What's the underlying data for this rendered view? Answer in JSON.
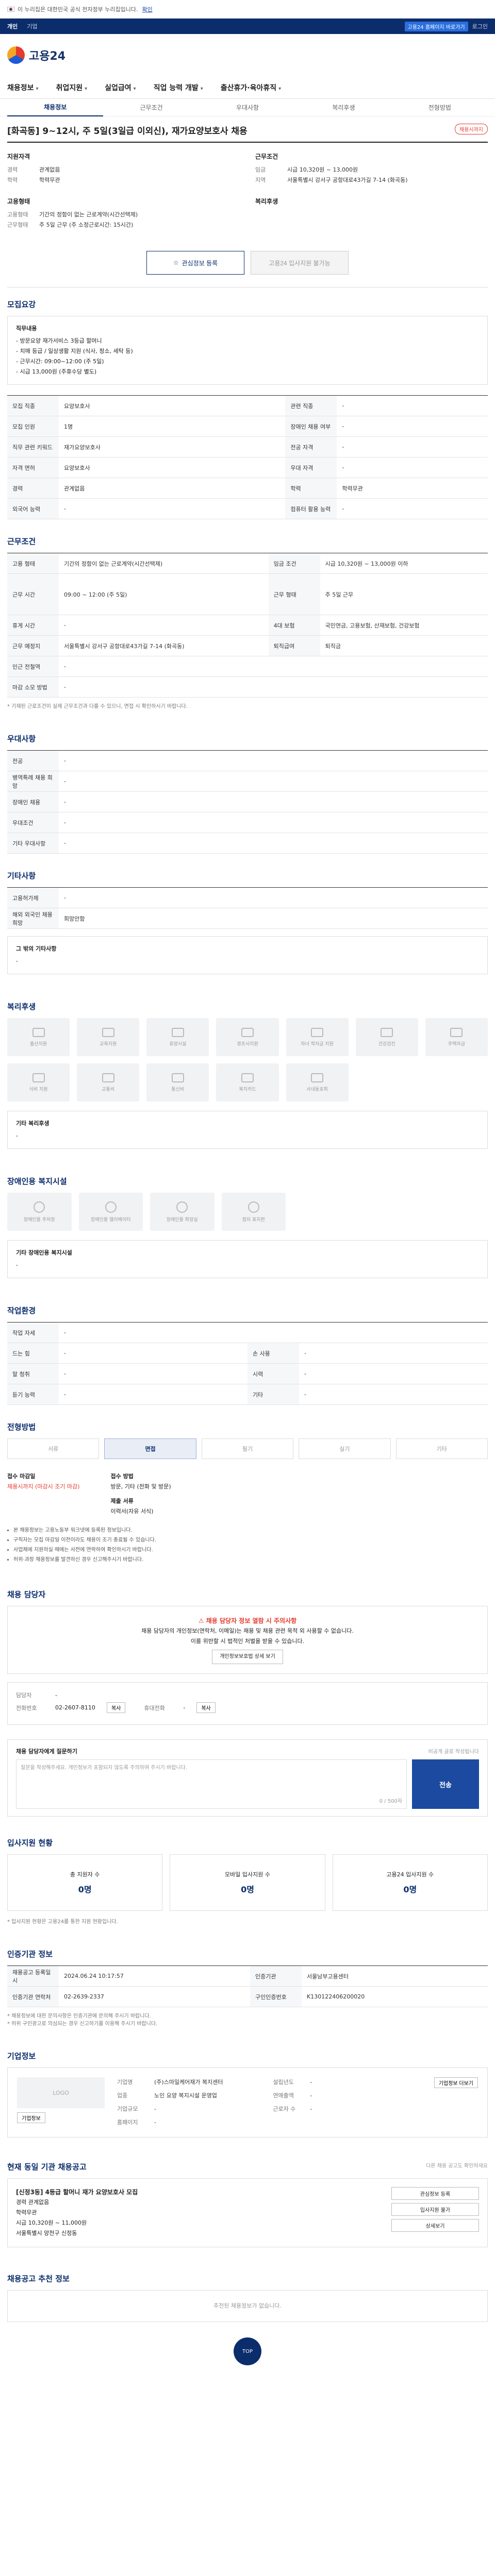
{
  "gov_banner": {
    "text": "이 누리집은 대한민국 공식 전자정부 누리집입니다.",
    "link": "확인"
  },
  "topbar": {
    "items": [
      "개인",
      "기업"
    ],
    "right_badge": "고용24 홈페이지 바로가기",
    "right_link": "로그인"
  },
  "logo": {
    "text": "고용24"
  },
  "gnb": [
    "채용정보",
    "취업지원",
    "실업급여",
    "직업 능력 개발",
    "출산휴가·육아휴직"
  ],
  "subnav": [
    "채용정보",
    "근무조건",
    "우대사항",
    "복리후생",
    "전형방법"
  ],
  "job": {
    "title": "[화곡동] 9~12시, 주 5일(3일급 이외신), 재가요양보호사 채용",
    "badge": "채용시까지"
  },
  "summary": {
    "left": [
      {
        "heading": "지원자격",
        "rows": [
          [
            "경력",
            "관계없음"
          ],
          [
            "학력",
            "학력무관"
          ]
        ]
      },
      {
        "heading": "고용형태",
        "rows": [
          [
            "고용형태",
            "기간의 정함이 없는 근로계약(시간선택제)"
          ],
          [
            "근무형태",
            "주 5일 근무 (주 소정근로시간: 15시간)"
          ]
        ]
      }
    ],
    "right": [
      {
        "heading": "근무조건",
        "rows": [
          [
            "임금",
            "시급 10,320원 ~ 13,000원"
          ],
          [
            "지역",
            "서울특별시 강서구 공항대로43가길 7-14 (화곡동)"
          ]
        ]
      },
      {
        "heading": "복리후생",
        "rows": []
      }
    ],
    "btn_save": "관심정보 등록",
    "btn_apply": "고용24 입사지원 불가능"
  },
  "recruit": {
    "title": "모집요강",
    "box_title": "직무내용",
    "box_lines": [
      "- 방문요양 재가서비스 3등급 할머니",
      "- 치매 등급 / 일상생활 지원 (식사, 청소, 세탁 등)",
      "- 근무시간: 09:00~12:00 (주 5일)",
      "- 시급 13,000원 (주휴수당 별도)"
    ],
    "rows": [
      [
        "모집 직종",
        "요양보호사",
        "관련 직종",
        "-"
      ],
      [
        "모집 인원",
        "1명",
        "장애인 채용 여부",
        "-"
      ],
      [
        "직무 관련 키워드",
        "재가요양보호사",
        "전공 자격",
        "-"
      ],
      [
        "자격 면허",
        "요양보호사",
        "우대 자격",
        "-"
      ],
      [
        "경력",
        "관계없음",
        "학력",
        "학력무관"
      ],
      [
        "외국어 능력",
        "-",
        "컴퓨터 활용 능력",
        "-"
      ]
    ]
  },
  "conditions": {
    "title": "근무조건",
    "rows": [
      [
        "고용 형태",
        "기간의 정함이 없는 근로계약(시간선택제)",
        "임금 조건",
        "시급 10,320원 ~ 13,000원 이하"
      ],
      [
        "근무 시간",
        "09:00 ~ 12:00 (주 5일)",
        "근무 형태",
        "주 5일 근무"
      ],
      [
        "휴게 시간",
        "-",
        "4대 보험",
        "국민연금, 고용보험, 산재보험, 건강보험"
      ],
      [
        "근무 예정지",
        "서울특별시 강서구 공항대로43가길 7-14 (화곡동)",
        "퇴직급여",
        "퇴직금"
      ],
      [
        "인근 전철역",
        "-",
        "",
        ""
      ],
      [
        "마감 소모 방법",
        "-",
        "",
        ""
      ]
    ],
    "note": "* 기재된 근로조건이 실제 근무조건과 다를 수 있으니, 면접 시 확인하시기 바랍니다."
  },
  "preferences": {
    "title": "우대사항",
    "rows": [
      [
        "전공",
        "-"
      ],
      [
        "병역특례 채용 희망",
        "-"
      ],
      [
        "장애인 채용",
        "-"
      ],
      [
        "우대조건",
        "-"
      ],
      [
        "기타 우대사항",
        "-"
      ]
    ]
  },
  "other_info": {
    "title": "기타사항",
    "rows": [
      [
        "고용허가제",
        "-"
      ],
      [
        "해외 외국인 채용 희망",
        "희망안함"
      ]
    ],
    "extra_label": "그 밖의 기타사항",
    "extra_value": "-"
  },
  "welfare": {
    "title": "복리후생",
    "tiles": [
      "출산지원",
      "교육지원",
      "휴양시설",
      "경조사지원",
      "자녀 학자금 지원",
      "건강검진",
      "주택자금",
      "식비 지원",
      "교통비",
      "통신비",
      "복지카드",
      "사내동호회"
    ],
    "extra_label": "기타 복리후생",
    "extra_value": "-"
  },
  "disability": {
    "title": "장애인용 복지시설",
    "tiles": [
      "장애인용 주차장",
      "장애인용 엘리베이터",
      "장애인용 화장실",
      "점자 표지판"
    ],
    "extra_label": "기타 장애인용 복지시설",
    "extra_value": "-"
  },
  "workplace": {
    "title": "작업환경",
    "rows": [
      [
        "작업 자세",
        "-",
        "",
        ""
      ],
      [
        "드는 힘",
        "-",
        "손 사용",
        "-"
      ],
      [
        "말 청취",
        "-",
        "시력",
        "-"
      ],
      [
        "듣기 능력",
        "-",
        "기타",
        "-"
      ]
    ]
  },
  "process": {
    "title": "전형방법",
    "steps": [
      "서류",
      "면접",
      "필기",
      "실기",
      "기타"
    ],
    "active": 1,
    "deadline_label": "접수 마감일",
    "deadline_value": "채용시까지 (마감시 조기 마감)",
    "method_label": "접수 방법",
    "method_value": "방문, 기타 (전화 및 방문)",
    "docs_label": "제출 서류",
    "docs_value": "이력서(자유 서식)",
    "bullets": [
      "본 채용정보는 고용노동부 워크넷에 등록된 정보입니다.",
      "구직자는 모집 마감일 이전이라도 채용이 조기 종료될 수 있습니다.",
      "사업체에 지원하실 때에는 사전에 연락하여 확인하시기 바랍니다.",
      "허위·과장 채용정보를 발견하신 경우 신고해주시기 바랍니다."
    ]
  },
  "contact": {
    "title": "채용 담당자",
    "alert_title": "채용 담당자 정보 열람 시 주의사항",
    "alert_lines": [
      "채용 담당자의 개인정보(연락처, 이메일)는 채용 및 채용 관련 목적 외 사용할 수 없습니다.",
      "이를 위반할 시 법적인 처벌을 받을 수 있습니다."
    ],
    "alert_btn": "개인정보보호법 상세 보기",
    "rows": [
      [
        "담당자",
        "-"
      ],
      [
        "전화번호",
        "02-2607-8110"
      ],
      [
        "휴대전화",
        "-"
      ]
    ],
    "btn_copy": "복사",
    "btn_copy2": "복사"
  },
  "question": {
    "title": "채용 담당자에게 질문하기",
    "note": "비공개 글로 작성됩니다",
    "placeholder": "질문을 작성해주세요. 개인정보가 포함되지 않도록 주의하여 주시기 바랍니다.",
    "count": "0 / 500자",
    "send": "전송"
  },
  "apply_status": {
    "title": "입사지원 현황",
    "cards": [
      [
        "총 지원자 수",
        "0명"
      ],
      [
        "모바일 입사지원 수",
        "0명"
      ],
      [
        "고용24 입사지원 수",
        "0명"
      ]
    ],
    "note": "* 입사지원 현황은 고용24를 통한 지원 현황입니다."
  },
  "agency": {
    "title": "인증기관 정보",
    "rows": [
      [
        "채용공고 등록일시",
        "2024.06.24 10:17:57",
        "인증기관",
        "서울남부고용센터"
      ],
      [
        "인증기관 연락처",
        "02-2639-2337",
        "구인인증번호",
        "K130122406200020"
      ]
    ],
    "notes": [
      "* 채용정보에 대한 문의사항은 인증기관에 문의해 주시기 바랍니다.",
      "* 허위 구인광고로 의심되는 경우 신고하기를 이용해 주시기 바랍니다."
    ]
  },
  "company": {
    "title": "기업정보",
    "logo_placeholder": "LOGO",
    "left_btn": "기업정보",
    "rows": [
      [
        "기업명",
        "(주)스마일케어재가 복지센터"
      ],
      [
        "업종",
        "노인 요양 복지시설 운영업"
      ],
      [
        "기업규모",
        "-"
      ],
      [
        "설립년도",
        "-"
      ],
      [
        "연매출액",
        "-"
      ],
      [
        "근로자 수",
        "-"
      ],
      [
        "홈페이지",
        "-"
      ]
    ],
    "right_btn": "기업정보 더보기"
  },
  "other_jobs": {
    "title": "현재 동일 기관 채용공고",
    "note": "다른 채용 공고도 확인하세요",
    "item": {
      "title": "[신정3동] 4등급 할머니 재가 요양보호사 모집",
      "meta": [
        "경력 관계없음",
        "학력무관",
        "시급 10,320원 ~ 11,000원",
        "서울특별시 양천구 신정동"
      ]
    },
    "side": [
      "관심정보 등록",
      "입사지원 불가",
      "상세보기"
    ]
  },
  "recommend": {
    "title": "채용공고 추천 정보",
    "empty": "추천된 채용정보가 없습니다."
  },
  "top_btn": "TOP"
}
